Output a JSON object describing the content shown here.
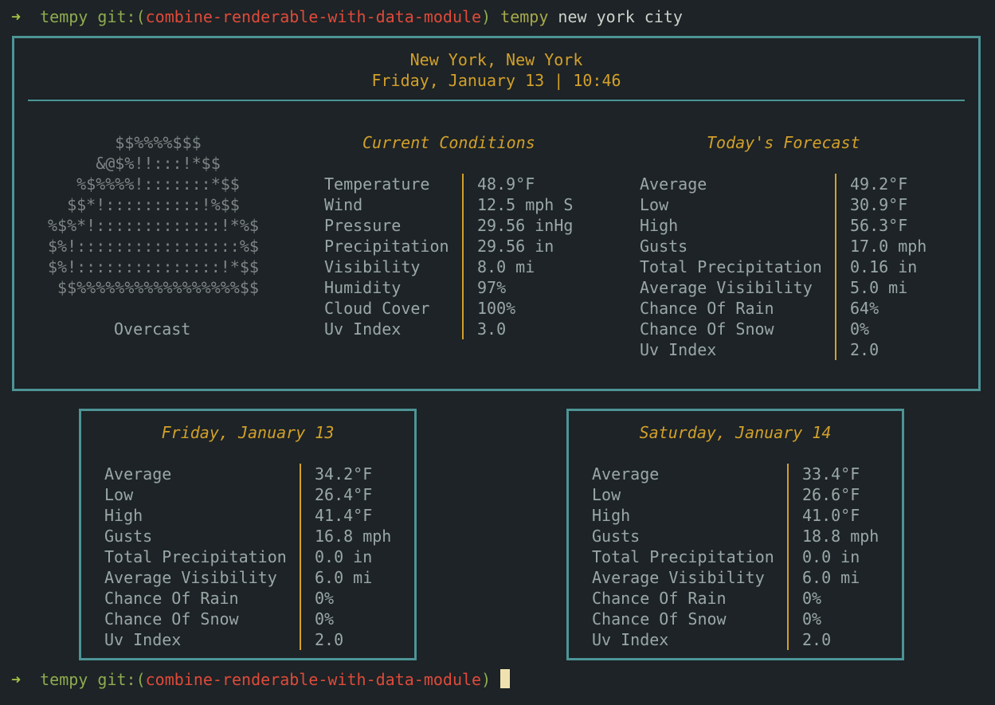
{
  "terminal": {
    "prompt_arrow": "➜",
    "dir": "tempy",
    "git_prefix": "git:(",
    "branch": "combine-renderable-with-data-module",
    "git_suffix": ")",
    "command_name": "tempy",
    "command_args": "new york city"
  },
  "current": {
    "location": "New York, New York",
    "datetime": "Friday, January 13 | 10:46",
    "condition_label": "Overcast",
    "ascii_art": [
      "       $$%%%%$$$",
      "     &@$%!!:::!*$$",
      "   %$%%%%!:::::::*$$",
      "  $$*!::::::::::!%$$",
      "%$%*!:::::::::::::!*%$",
      "$%!:::::::::::::::::%$",
      "$%!:::::::::::::::!*$$",
      " $$%%%%%%%%%%%%%%%%%$$"
    ],
    "conditions_title": "Current Conditions",
    "conditions": [
      {
        "label": "Temperature",
        "value": "48.9°F"
      },
      {
        "label": "Wind",
        "value": "12.5 mph S"
      },
      {
        "label": "Pressure",
        "value": "29.56 inHg"
      },
      {
        "label": "Precipitation",
        "value": "29.56 in"
      },
      {
        "label": "Visibility",
        "value": "8.0 mi"
      },
      {
        "label": "Humidity",
        "value": "97%"
      },
      {
        "label": "Cloud Cover",
        "value": "100%"
      },
      {
        "label": "Uv Index",
        "value": "3.0"
      }
    ],
    "forecast_title": "Today's Forecast",
    "forecast": [
      {
        "label": "Average",
        "value": "49.2°F"
      },
      {
        "label": "Low",
        "value": "30.9°F"
      },
      {
        "label": "High",
        "value": "56.3°F"
      },
      {
        "label": "Gusts",
        "value": "17.0 mph"
      },
      {
        "label": "Total Precipitation",
        "value": "0.16 in"
      },
      {
        "label": "Average Visibility",
        "value": "5.0 mi"
      },
      {
        "label": "Chance Of Rain",
        "value": "64%"
      },
      {
        "label": "Chance Of Snow",
        "value": "0%"
      },
      {
        "label": "Uv Index",
        "value": "2.0"
      }
    ]
  },
  "days": [
    {
      "title": "Friday, January 13",
      "rows": [
        {
          "label": "Average",
          "value": "34.2°F"
        },
        {
          "label": "Low",
          "value": "26.4°F"
        },
        {
          "label": "High",
          "value": "41.4°F"
        },
        {
          "label": "Gusts",
          "value": "16.8 mph"
        },
        {
          "label": "Total Precipitation",
          "value": "0.0 in"
        },
        {
          "label": "Average Visibility",
          "value": "6.0 mi"
        },
        {
          "label": "Chance Of Rain",
          "value": "0%"
        },
        {
          "label": "Chance Of Snow",
          "value": "0%"
        },
        {
          "label": "Uv Index",
          "value": "2.0"
        }
      ]
    },
    {
      "title": "Saturday, January 14",
      "rows": [
        {
          "label": "Average",
          "value": "33.4°F"
        },
        {
          "label": "Low",
          "value": "26.6°F"
        },
        {
          "label": "High",
          "value": "41.0°F"
        },
        {
          "label": "Gusts",
          "value": "18.8 mph"
        },
        {
          "label": "Total Precipitation",
          "value": "0.0 in"
        },
        {
          "label": "Average Visibility",
          "value": "6.0 mi"
        },
        {
          "label": "Chance Of Rain",
          "value": "0%"
        },
        {
          "label": "Chance Of Snow",
          "value": "0%"
        },
        {
          "label": "Uv Index",
          "value": "2.0"
        }
      ]
    }
  ],
  "colors": {
    "background": "#1d2326",
    "border": "#4d9496",
    "accent": "#d2a02a",
    "text": "#9aa7a7",
    "branch": "#df4a3a",
    "prompt": "#a3c248"
  }
}
